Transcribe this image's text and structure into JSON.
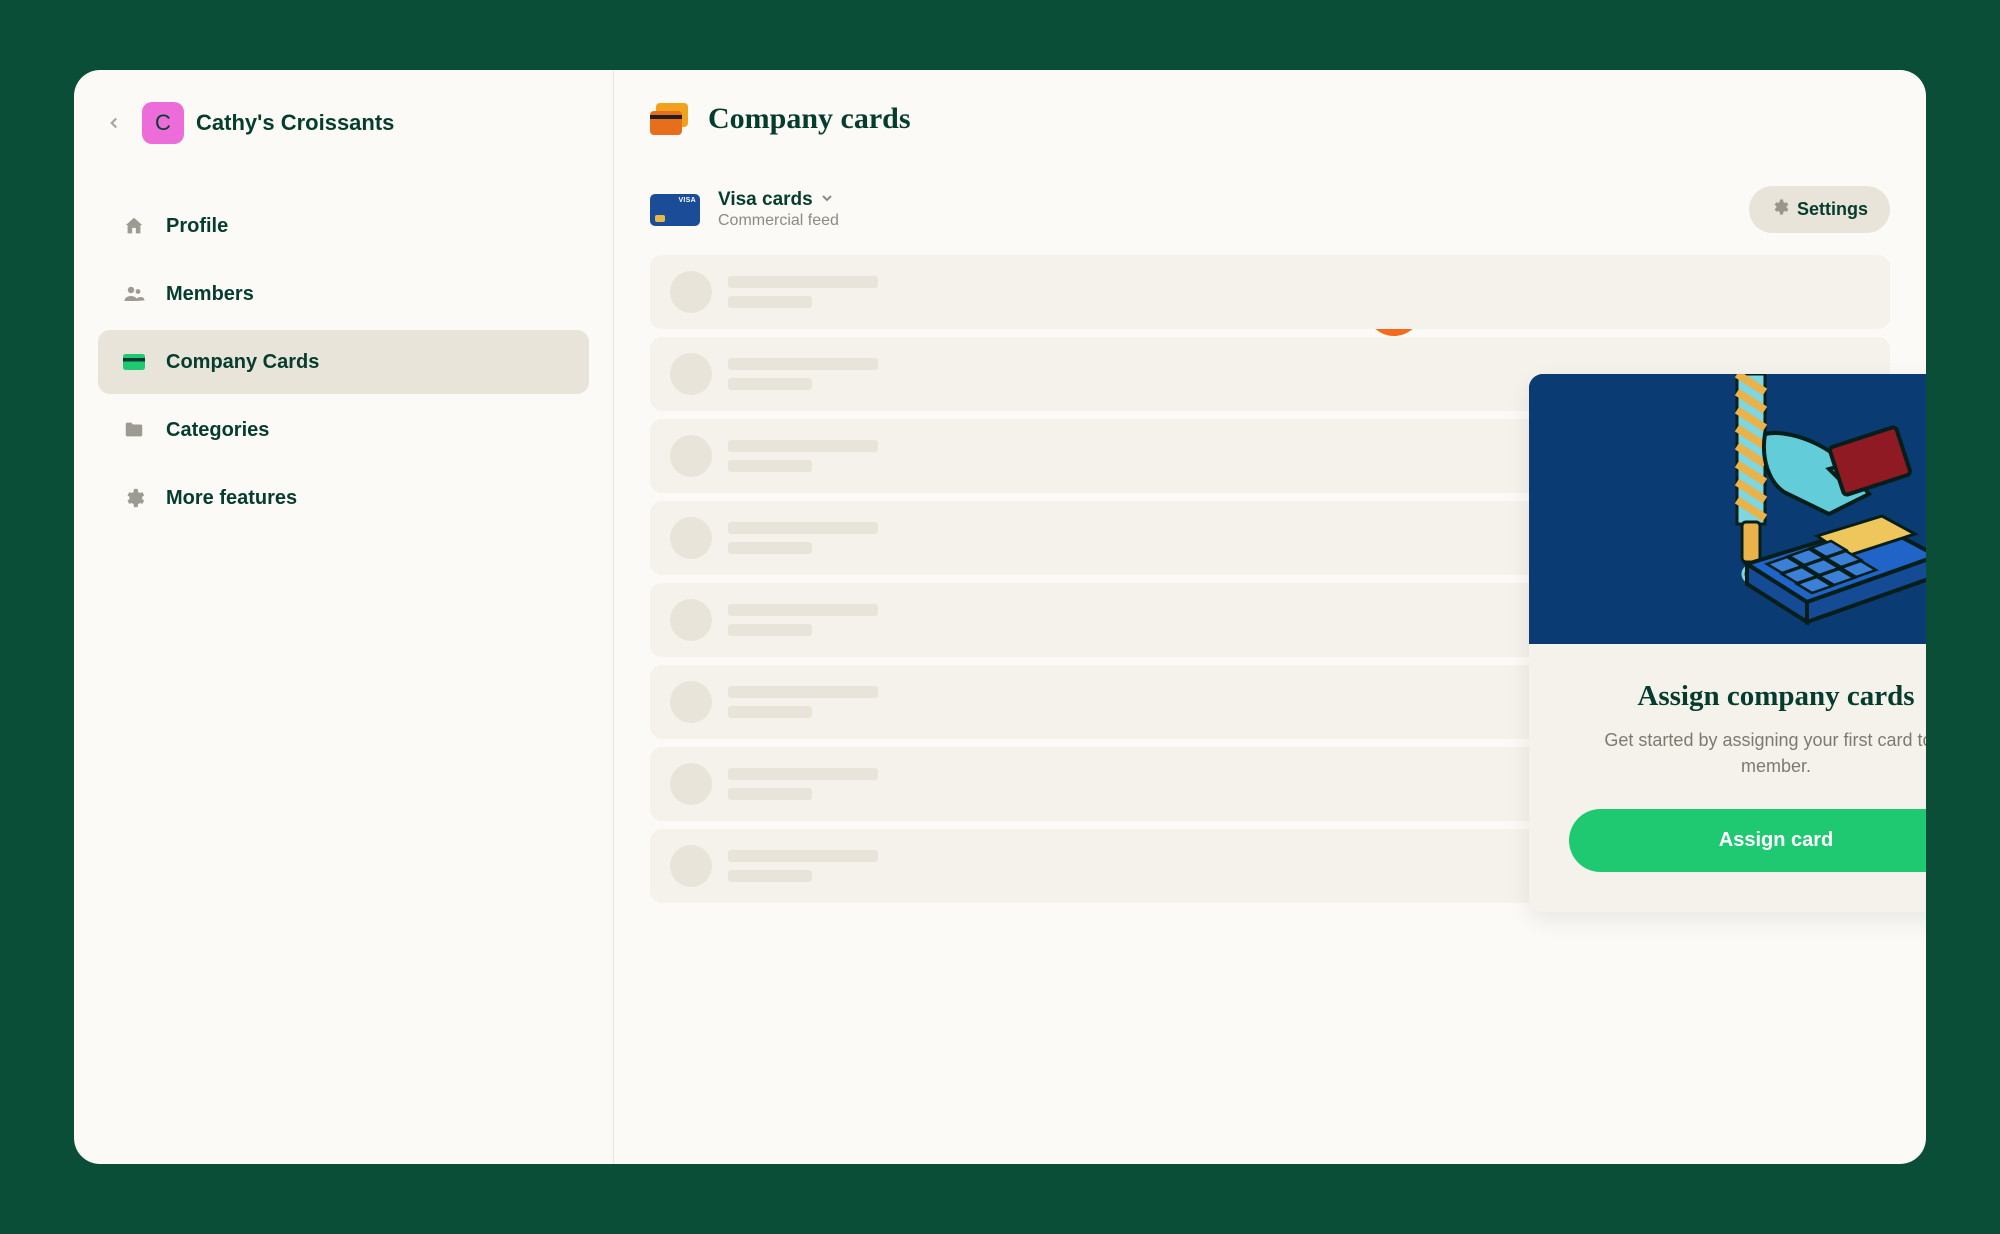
{
  "workspace": {
    "avatar_letter": "C",
    "name": "Cathy's Croissants"
  },
  "sidebar": {
    "items": [
      {
        "label": "Profile",
        "icon": "home-icon",
        "active": false
      },
      {
        "label": "Members",
        "icon": "members-icon",
        "active": false
      },
      {
        "label": "Company Cards",
        "icon": "card-icon",
        "active": true
      },
      {
        "label": "Categories",
        "icon": "folder-icon",
        "active": false
      },
      {
        "label": "More features",
        "icon": "gear-icon",
        "active": false
      }
    ]
  },
  "main": {
    "title": "Company cards",
    "feed": {
      "title": "Visa cards",
      "subtitle": "Commercial feed"
    },
    "settings_label": "Settings"
  },
  "modal": {
    "title": "Assign company cards",
    "subtitle": "Get started by assigning your first card to a member.",
    "cta": "Assign card"
  },
  "colors": {
    "brand_green": "#1ec971",
    "dark_green": "#063c2e",
    "bg_green": "#0b4e37",
    "accent_orange": "#f36a1c"
  }
}
